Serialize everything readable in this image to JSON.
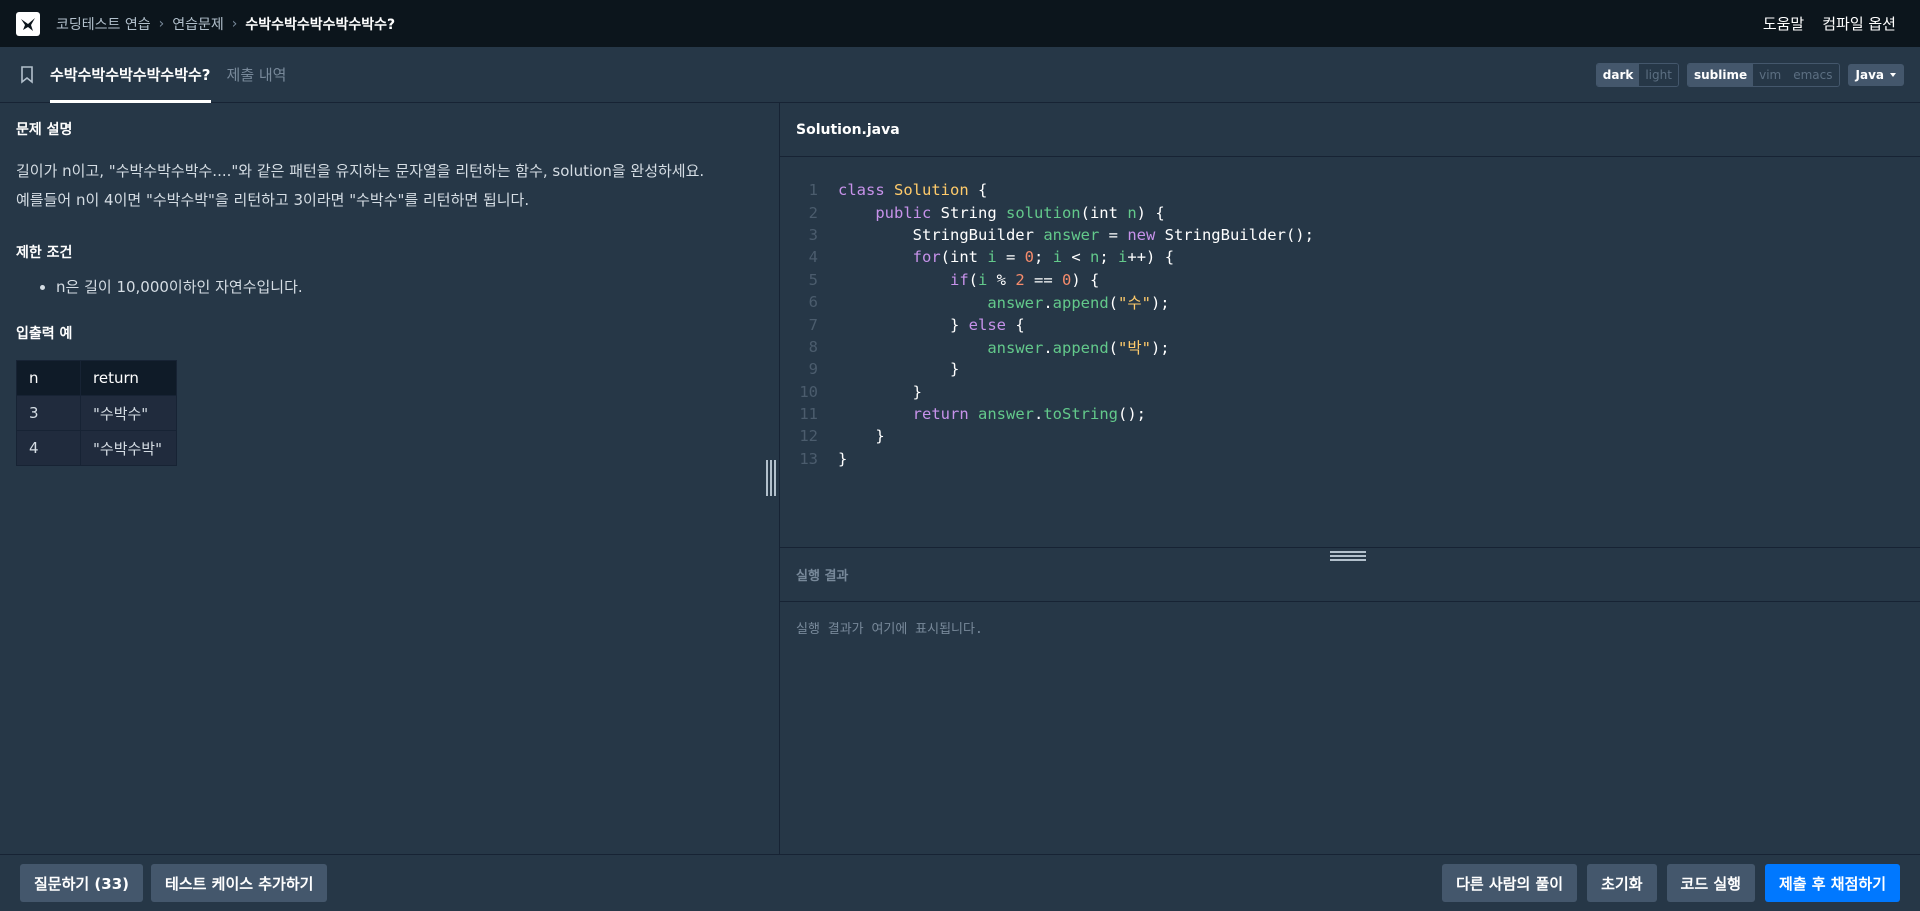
{
  "nav": {
    "breadcrumb": [
      "코딩테스트 연습",
      "연습문제",
      "수박수박수박수박수박수?"
    ],
    "help": "도움말",
    "compile_options": "컴파일 옵션"
  },
  "tabs": {
    "problem": "수박수박수박수박수박수?",
    "submissions": "제출 내역"
  },
  "toolbar": {
    "theme": [
      "dark",
      "light"
    ],
    "keymap": [
      "sublime",
      "vim",
      "emacs"
    ],
    "language": "Java"
  },
  "problem": {
    "title": "문제 설명",
    "desc_line1": "길이가 n이고, \"수박수박수박수....\"와 같은 패턴을 유지하는 문자열을 리턴하는 함수, solution을 완성하세요.",
    "desc_line2": "예를들어 n이 4이면 \"수박수박\"을 리턴하고 3이라면 \"수박수\"를 리턴하면 됩니다.",
    "limits_title": "제한 조건",
    "limits": [
      "n은 길이 10,000이하인 자연수입니다."
    ],
    "io_title": "입출력 예",
    "io_headers": [
      "n",
      "return"
    ],
    "io_rows": [
      [
        "3",
        "\"수박수\""
      ],
      [
        "4",
        "\"수박수박\""
      ]
    ]
  },
  "editor": {
    "filename": "Solution.java",
    "line_numbers": [
      "1",
      "2",
      "3",
      "4",
      "5",
      "6",
      "7",
      "8",
      "9",
      "10",
      "11",
      "12",
      "13"
    ]
  },
  "result": {
    "title": "실행 결과",
    "placeholder": "실행 결과가 여기에 표시됩니다."
  },
  "bottom": {
    "ask": "질문하기 (33)",
    "add_testcase": "테스트 케이스 추가하기",
    "others": "다른 사람의 풀이",
    "reset": "초기화",
    "run": "코드 실행",
    "submit": "제출 후 채점하기"
  }
}
